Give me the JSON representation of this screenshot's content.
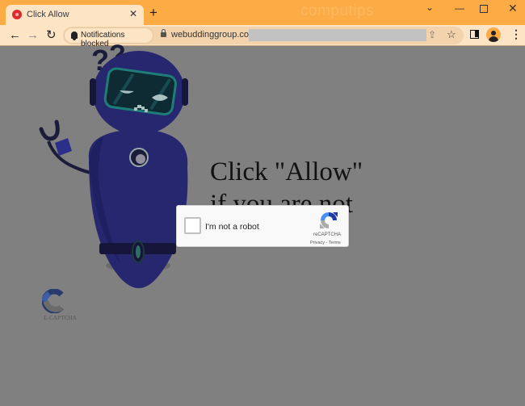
{
  "browser": {
    "tab": {
      "title": "Click Allow",
      "close_glyph": "✕"
    },
    "new_tab_glyph": "+",
    "watermark": "computips",
    "window_controls": {
      "chevron": "⌄",
      "minimize": "—",
      "close": "✕"
    },
    "nav": {
      "back": "←",
      "forward": "→",
      "reload": "↻"
    },
    "notifications_chip": "Notifications blocked",
    "url": "webuddinggroup.com/",
    "share_glyph": "⇪",
    "star_glyph": "☆",
    "menu_glyph": "⋮"
  },
  "page": {
    "headline_line1": "Click \"Allow\"",
    "headline_line2": "if you are not",
    "logo_label": "E-CAPTCHA",
    "recaptcha": {
      "label": "I'm not a robot",
      "brand": "reCAPTCHA",
      "links": "Privacy - Terms",
      "checked": false
    }
  },
  "colors": {
    "titlebar": "#fdab45",
    "toolbar": "#fde4c5",
    "overlay": "#808080",
    "robot_body": "#26276f",
    "visor": "#0e2a33",
    "visor_rim": "#1f7d77"
  }
}
